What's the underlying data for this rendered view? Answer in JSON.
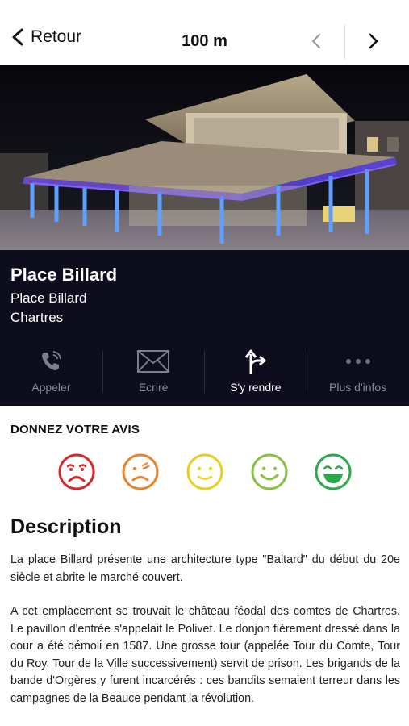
{
  "topbar": {
    "back_label": "Retour",
    "distance": "100 m"
  },
  "place": {
    "name": "Place Billard",
    "address_line1": "Place Billard",
    "address_line2": "Chartres"
  },
  "actions": [
    {
      "label": "Appeler",
      "icon": "phone-icon",
      "active": false
    },
    {
      "label": "Ecrire",
      "icon": "envelope-icon",
      "active": false
    },
    {
      "label": "S'y rendre",
      "icon": "directions-icon",
      "active": true
    },
    {
      "label": "Plus d'infos",
      "icon": "more-icon",
      "active": false
    }
  ],
  "rating": {
    "title": "DONNEZ VOTRE AVIS",
    "faces": [
      {
        "mood": "very-unhappy",
        "color": "#d9262b"
      },
      {
        "mood": "unhappy",
        "color": "#e8822c"
      },
      {
        "mood": "neutral",
        "color": "#e8cf1c"
      },
      {
        "mood": "happy",
        "color": "#86c142"
      },
      {
        "mood": "very-happy",
        "color": "#2aa84a"
      }
    ]
  },
  "description": {
    "title": "Description",
    "paragraph1": "La place Billard présente une architecture type \"Baltard\" du début du 20e siècle et abrite le marché couvert.",
    "paragraph2": "A cet emplacement se trouvait le château féodal des comtes de Chartres. Le pavillon d'entrée s'appelait le Polivet. Le donjon fièrement dressé dans la cour a été démoli en 1587. Une grosse tour (appelée Tour du Comte, Tour du Roy, Tour de la Ville successivement) servit de prison. Les brigands de la bande d'Orgères y furent incarcérés : ces bandits semaient terreur dans les campagnes de la Beauce pendant la révolution."
  },
  "colors": {
    "panel_bg": "#0e0d1d",
    "action_inactive": "#8a8a96",
    "accent_lights": "#5a4cff"
  }
}
